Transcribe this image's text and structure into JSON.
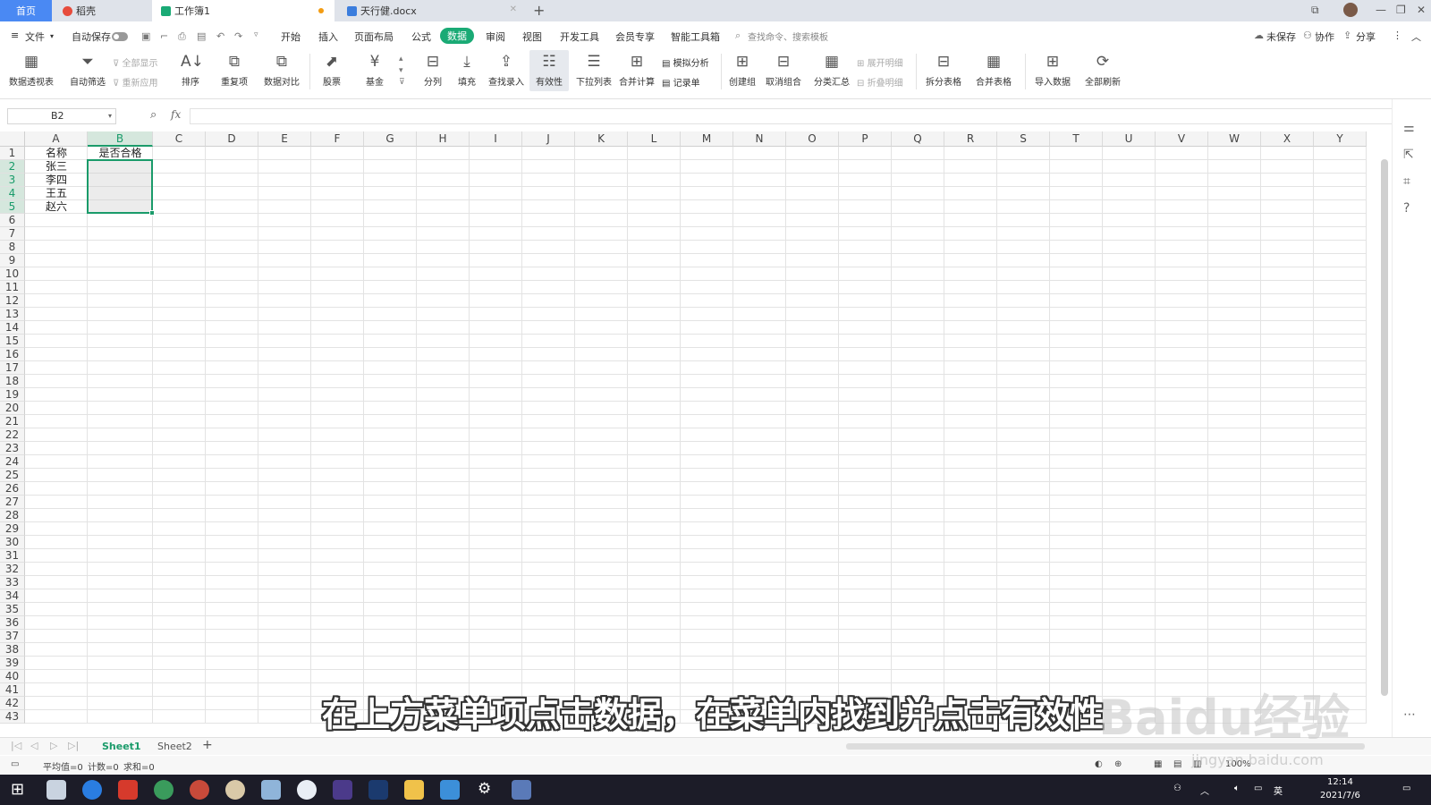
{
  "tabs": {
    "home": "首页",
    "doc1": "稻壳",
    "doc2": "工作簿1",
    "doc3": "天行健.docx"
  },
  "menu": {
    "file": "文件",
    "autosave": "自动保存",
    "items": [
      "开始",
      "插入",
      "页面布局",
      "公式",
      "数据",
      "审阅",
      "视图",
      "开发工具",
      "会员专享",
      "智能工具箱"
    ],
    "active": "数据",
    "search": "查找命令、搜索模板",
    "unsaved": "未保存",
    "collab": "协作",
    "share": "分享"
  },
  "ribbon": {
    "pivot": "数据透视表",
    "autofilter": "自动筛选",
    "showall": "全部显示",
    "reapply": "重新应用",
    "sort": "排序",
    "dup": "重复项",
    "compare": "数据对比",
    "stock": "股票",
    "fund": "基金",
    "split": "分列",
    "fill": "填充",
    "lookup": "查找录入",
    "validity": "有效性",
    "dropdown": "下拉列表",
    "consolidate": "合并计算",
    "whatif": "模拟分析",
    "record": "记录单",
    "group": "创建组",
    "ungroup": "取消组合",
    "subtotal": "分类汇总",
    "expand": "展开明细",
    "collapse": "折叠明细",
    "splittable": "拆分表格",
    "mergetable": "合并表格",
    "import": "导入数据",
    "refresh": "全部刷新"
  },
  "formula": {
    "namebox": "B2",
    "fx": "fx",
    "value": ""
  },
  "grid": {
    "columns": [
      "A",
      "B",
      "C",
      "D",
      "E",
      "F",
      "G",
      "H",
      "I",
      "J",
      "K",
      "L",
      "M",
      "N",
      "O",
      "P",
      "Q",
      "R",
      "S",
      "T",
      "U",
      "V",
      "W",
      "X",
      "Y"
    ],
    "row_count": 43,
    "cells": {
      "A1": "名称",
      "B1": "是否合格",
      "A2": "张三",
      "A3": "李四",
      "A4": "王五",
      "A5": "赵六"
    }
  },
  "sheets": [
    "Sheet1",
    "Sheet2"
  ],
  "active_sheet": "Sheet1",
  "status": {
    "avg": "平均值=0",
    "count": "计数=0",
    "sum": "求和=0",
    "zoom": "100%"
  },
  "taskbar": {
    "time": "12:14",
    "date": "2021/7/6",
    "lang": "英"
  },
  "caption": "在上方菜单项点击数据，在菜单内找到并点击有效性",
  "watermark": {
    "brand": "Baidu经验",
    "url": "jingyan.baidu.com"
  },
  "colors": {
    "accent": "#1aaa75",
    "tab_blue": "#4a89f3",
    "selection": "#1a9b6a"
  }
}
